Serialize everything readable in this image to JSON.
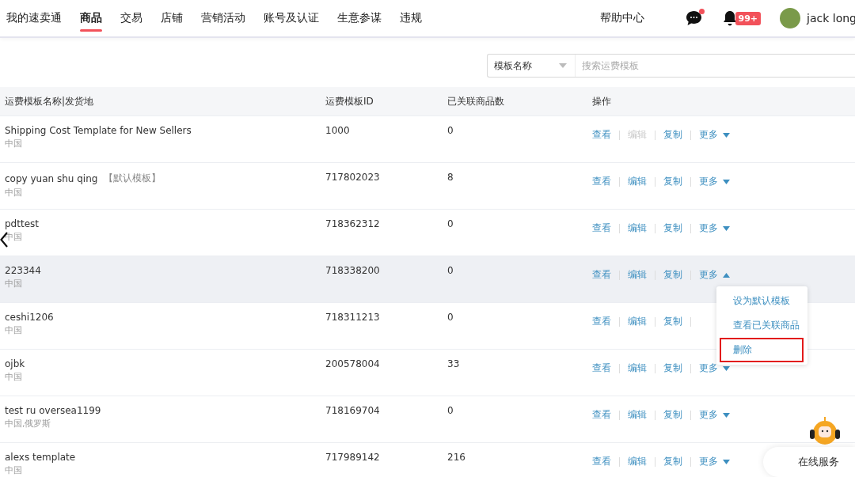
{
  "nav": {
    "items": [
      {
        "label": "我的速卖通",
        "selected": false
      },
      {
        "label": "商品",
        "selected": true
      },
      {
        "label": "交易",
        "selected": false
      },
      {
        "label": "店铺",
        "selected": false
      },
      {
        "label": "营销活动",
        "selected": false
      },
      {
        "label": "账号及认证",
        "selected": false
      },
      {
        "label": "生意参谋",
        "selected": false
      },
      {
        "label": "违规",
        "selected": false
      }
    ],
    "help": "帮助中心",
    "messages_unread": true,
    "notifications_badge": "99+",
    "user": "jack long"
  },
  "search": {
    "field_label": "模板名称",
    "placeholder": "搜索运费模板"
  },
  "table": {
    "columns": [
      "运费模板名称|发货地",
      "运费模板ID",
      "已关联商品数",
      "操作"
    ],
    "rows": [
      {
        "name": "Shipping Cost Template for New Sellers",
        "origin": "中国",
        "id": "1000",
        "count": "0",
        "hovered": false,
        "actions": [
          {
            "label": "查看",
            "disabled": false
          },
          {
            "label": "编辑",
            "disabled": true
          },
          {
            "label": "复制",
            "disabled": false
          }
        ],
        "more": {
          "label": "更多",
          "expanded": false
        }
      },
      {
        "name": "copy yuan shu qing",
        "tag": "【默认模板】",
        "origin": "中国",
        "id": "717802023",
        "count": "8",
        "hovered": false,
        "actions": [
          {
            "label": "查看",
            "disabled": false
          },
          {
            "label": "编辑",
            "disabled": false
          },
          {
            "label": "复制",
            "disabled": false
          }
        ],
        "more": {
          "label": "更多",
          "expanded": false
        }
      },
      {
        "name": "pdttest",
        "origin": "中国",
        "id": "718362312",
        "count": "0",
        "hovered": false,
        "actions": [
          {
            "label": "查看",
            "disabled": false
          },
          {
            "label": "编辑",
            "disabled": false
          },
          {
            "label": "复制",
            "disabled": false
          }
        ],
        "more": {
          "label": "更多",
          "expanded": false
        }
      },
      {
        "name": "223344",
        "origin": "中国",
        "id": "718338200",
        "count": "0",
        "hovered": true,
        "actions": [
          {
            "label": "查看",
            "disabled": false
          },
          {
            "label": "编辑",
            "disabled": false
          },
          {
            "label": "复制",
            "disabled": false
          }
        ],
        "more": {
          "label": "更多",
          "expanded": true,
          "menu": [
            {
              "label": "设为默认模板",
              "highlighted": false
            },
            {
              "label": "查看已关联商品",
              "highlighted": false
            },
            {
              "label": "删除",
              "highlighted": true
            }
          ]
        }
      },
      {
        "name": "ceshi1206",
        "origin": "中国",
        "id": "718311213",
        "count": "0",
        "hovered": false,
        "actions": [
          {
            "label": "查看",
            "disabled": false
          },
          {
            "label": "编辑",
            "disabled": false
          },
          {
            "label": "复制",
            "disabled": false
          }
        ]
      },
      {
        "name": "ojbk",
        "origin": "中国",
        "id": "200578004",
        "count": "33",
        "hovered": false,
        "actions": [
          {
            "label": "查看",
            "disabled": false
          },
          {
            "label": "编辑",
            "disabled": false
          },
          {
            "label": "复制",
            "disabled": false
          }
        ],
        "more": {
          "label": "更多",
          "expanded": false
        }
      },
      {
        "name": "test ru oversea1199",
        "origin": "中国,俄罗斯",
        "id": "718169704",
        "count": "0",
        "hovered": false,
        "actions": [
          {
            "label": "查看",
            "disabled": false
          },
          {
            "label": "编辑",
            "disabled": false
          },
          {
            "label": "复制",
            "disabled": false
          }
        ],
        "more": {
          "label": "更多",
          "expanded": false
        }
      },
      {
        "name": "alexs template",
        "origin": "中国",
        "id": "717989142",
        "count": "216",
        "hovered": false,
        "actions": [
          {
            "label": "查看",
            "disabled": false
          },
          {
            "label": "编辑",
            "disabled": false
          },
          {
            "label": "复制",
            "disabled": false
          }
        ],
        "more": {
          "label": "更多",
          "expanded": false
        }
      }
    ]
  },
  "service_widget": {
    "label": "在线服务"
  }
}
